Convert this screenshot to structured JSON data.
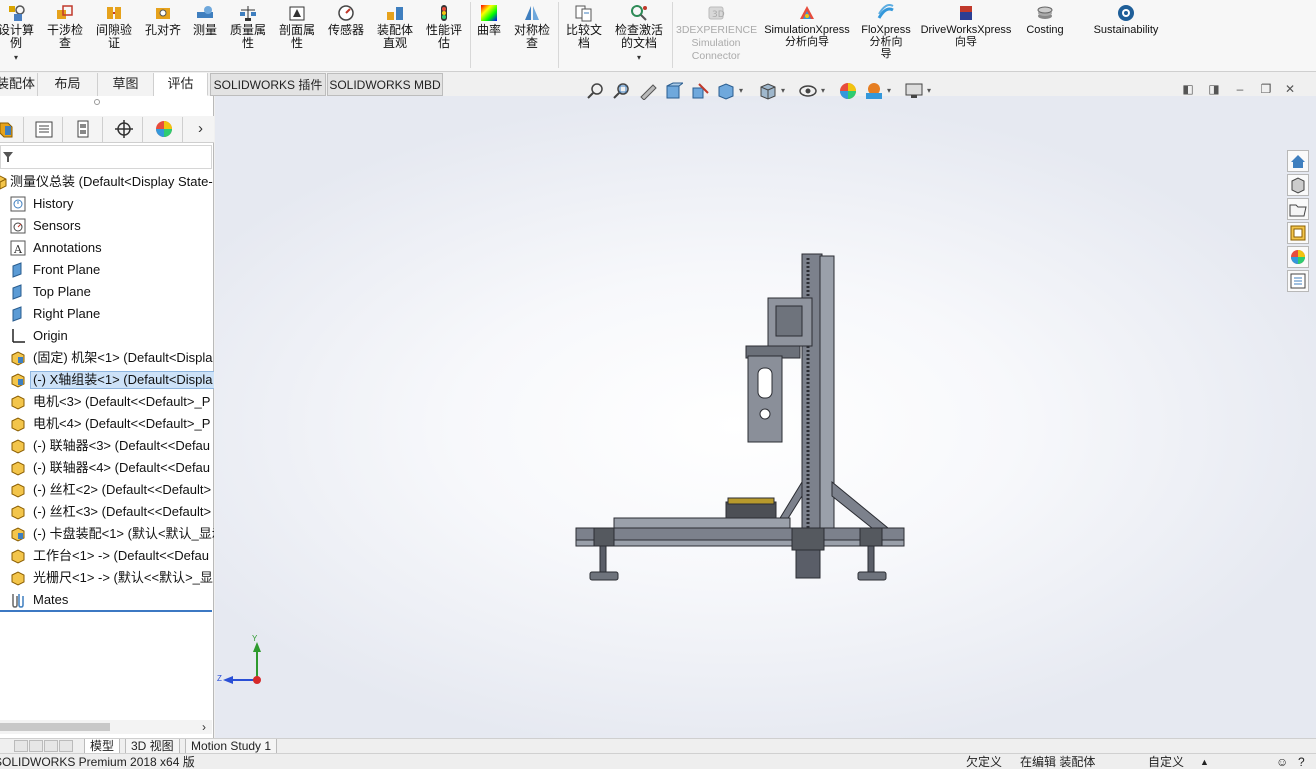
{
  "ribbon": {
    "buttons": [
      {
        "label": "设计算\n例"
      },
      {
        "label": "干涉检\n查"
      },
      {
        "label": "间隙验\n证"
      },
      {
        "label": "孔对齐"
      },
      {
        "label": "测量"
      },
      {
        "label": "质量属\n性"
      },
      {
        "label": "剖面属\n性"
      },
      {
        "label": "传感器"
      },
      {
        "label": "装配体\n直观"
      },
      {
        "label": "性能评\n估"
      },
      {
        "label": "曲率"
      },
      {
        "label": "对称检\n查"
      },
      {
        "label": "比较文\n档"
      },
      {
        "label": "检查激活\n的文档"
      },
      {
        "label": "3DEXPERIENCE\nSimulation\nConnector"
      },
      {
        "label": "SimulationXpress\n分析向导"
      },
      {
        "label": "FloXpress\n分析向\n导"
      },
      {
        "label": "DriveWorksXpress\n向导"
      },
      {
        "label": "Costing"
      },
      {
        "label": "Sustainability"
      }
    ]
  },
  "command_tabs": [
    {
      "label": "装配体"
    },
    {
      "label": "布局"
    },
    {
      "label": "草图"
    },
    {
      "label": "评估"
    },
    {
      "label": "SOLIDWORKS 插件"
    },
    {
      "label": "SOLIDWORKS MBD"
    }
  ],
  "feature_tree": {
    "root": "测量仪总装  (Default<Display State-",
    "items": [
      {
        "label": "History",
        "icon": "history-icon"
      },
      {
        "label": "Sensors",
        "icon": "sensor-icon"
      },
      {
        "label": "Annotations",
        "icon": "annotation-icon"
      },
      {
        "label": "Front Plane",
        "icon": "plane-icon"
      },
      {
        "label": "Top Plane",
        "icon": "plane-icon"
      },
      {
        "label": "Right Plane",
        "icon": "plane-icon"
      },
      {
        "label": "Origin",
        "icon": "origin-icon"
      },
      {
        "label": "(固定) 机架<1> (Default<Displa",
        "icon": "assembly-icon"
      },
      {
        "label": "(-) X轴组装<1> (Default<Displa",
        "icon": "assembly-icon"
      },
      {
        "label": "电机<3> (Default<<Default>_P",
        "icon": "part-icon"
      },
      {
        "label": "电机<4> (Default<<Default>_P",
        "icon": "part-icon"
      },
      {
        "label": "(-) 联轴器<3> (Default<<Defau",
        "icon": "part-icon"
      },
      {
        "label": "(-) 联轴器<4> (Default<<Defau",
        "icon": "part-icon"
      },
      {
        "label": "(-) 丝杠<2> (Default<<Default>",
        "icon": "part-icon"
      },
      {
        "label": "(-) 丝杠<3> (Default<<Default>",
        "icon": "part-icon"
      },
      {
        "label": "(-) 卡盘装配<1> (默认<默认_显示",
        "icon": "assembly-icon"
      },
      {
        "label": "工作台<1> -> (Default<<Defau",
        "icon": "part-icon"
      },
      {
        "label": "光栅尺<1> -> (默认<<默认>_显",
        "icon": "part-icon"
      },
      {
        "label": "Mates",
        "icon": "mates-icon"
      }
    ]
  },
  "triad": {
    "y": "Y",
    "z": "Z"
  },
  "bottom_tabs": [
    {
      "label": "模型"
    },
    {
      "label": "3D 视图"
    },
    {
      "label": "Motion Study 1"
    }
  ],
  "status": {
    "app": "SOLIDWORKS Premium 2018 x64 版",
    "definition": "欠定义",
    "editing": "在编辑 装配体",
    "units": "自定义"
  },
  "colors": {
    "accent": "#3c78c3",
    "selection": "#cde2f8",
    "model": "#5a5e68"
  }
}
